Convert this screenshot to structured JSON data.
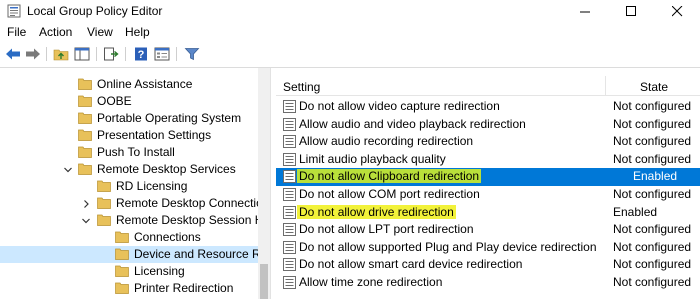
{
  "window": {
    "title": "Local Group Policy Editor"
  },
  "menu": [
    "File",
    "Action",
    "View",
    "Help"
  ],
  "toolbar": {
    "icons": [
      "back-arrow-icon",
      "forward-arrow-icon",
      "up-folder-icon",
      "show-hide-tree-icon",
      "export-list-icon",
      "help-icon",
      "properties-icon",
      "filter-icon"
    ]
  },
  "tree": {
    "items": [
      {
        "label": "Online Assistance"
      },
      {
        "label": "OOBE"
      },
      {
        "label": "Portable Operating System"
      },
      {
        "label": "Presentation Settings"
      },
      {
        "label": "Push To Install"
      },
      {
        "label": "Remote Desktop Services"
      },
      {
        "label": "RD Licensing"
      },
      {
        "label": "Remote Desktop Connectio"
      },
      {
        "label": "Remote Desktop Session Ho"
      },
      {
        "label": "Connections"
      },
      {
        "label": "Device and Resource Red"
      },
      {
        "label": "Licensing"
      },
      {
        "label": "Printer Redirection"
      }
    ]
  },
  "list": {
    "headers": {
      "setting": "Setting",
      "state": "State"
    },
    "rows": [
      {
        "setting": "Do not allow video capture redirection",
        "state": "Not configured"
      },
      {
        "setting": "Allow audio and video playback redirection",
        "state": "Not configured"
      },
      {
        "setting": "Allow audio recording redirection",
        "state": "Not configured"
      },
      {
        "setting": "Limit audio playback quality",
        "state": "Not configured"
      },
      {
        "setting": "Do not allow Clipboard redirection",
        "state": "Enabled"
      },
      {
        "setting": "Do not allow COM port redirection",
        "state": "Not configured"
      },
      {
        "setting": "Do not allow drive redirection",
        "state": "Enabled"
      },
      {
        "setting": "Do not allow LPT port redirection",
        "state": "Not configured"
      },
      {
        "setting": "Do not allow supported Plug and Play device redirection",
        "state": "Not configured"
      },
      {
        "setting": "Do not allow smart card device redirection",
        "state": "Not configured"
      },
      {
        "setting": "Allow time zone redirection",
        "state": "Not configured"
      }
    ]
  },
  "colors": {
    "selection": "#0078d7",
    "tree_selection": "#cce8ff",
    "highlight": "#f2f23a",
    "folder": "#e8c15a"
  }
}
